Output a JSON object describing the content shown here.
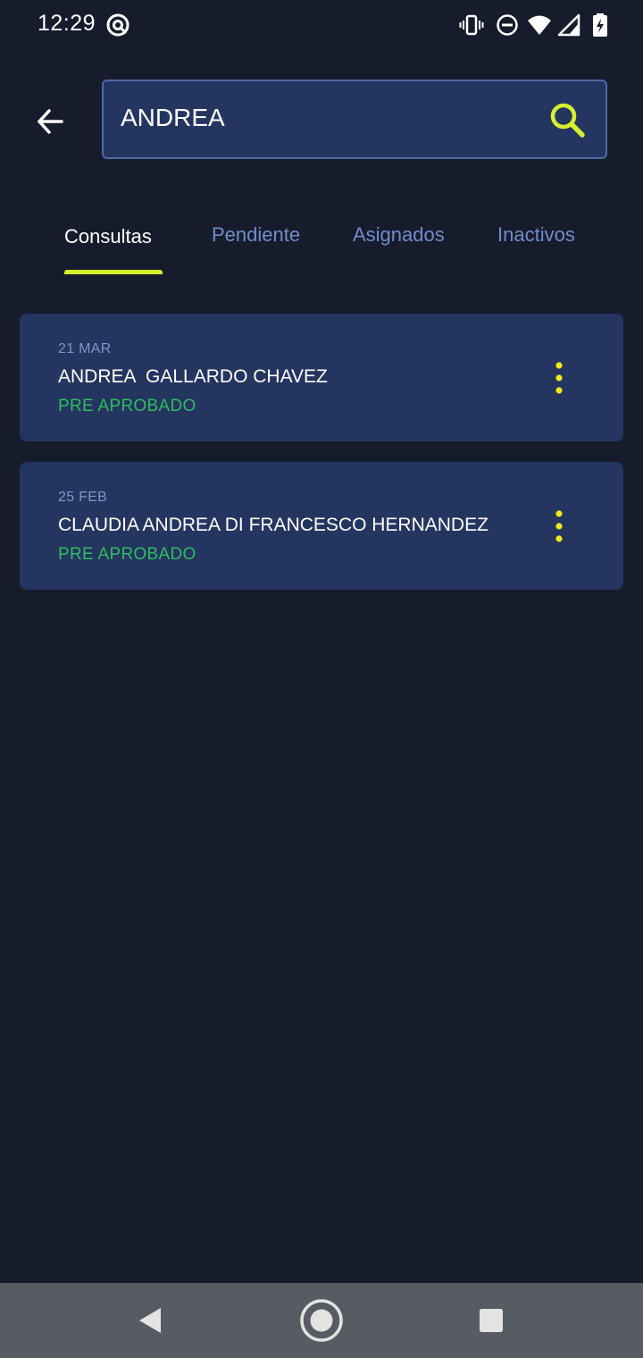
{
  "status_bar": {
    "time": "12:29"
  },
  "header": {
    "search_value": "ANDREA",
    "search_placeholder": ""
  },
  "tabs": [
    {
      "label": "Consultas",
      "active": true
    },
    {
      "label": "Pendiente",
      "active": false
    },
    {
      "label": "Asignados",
      "active": false
    },
    {
      "label": "Inactivos",
      "active": false
    }
  ],
  "results": [
    {
      "date": "21 MAR",
      "name": "ANDREA  GALLARDO CHAVEZ",
      "status": "PRE APROBADO"
    },
    {
      "date": "25 FEB",
      "name": "CLAUDIA ANDREA DI FRANCESCO HERNANDEZ",
      "status": "PRE APROBADO"
    }
  ],
  "colors": {
    "background": "#171c2c",
    "card": "#243560",
    "accent": "#d6f02e",
    "status_green": "#2ebd5f",
    "tab_inactive": "#6f8ccb"
  },
  "icons": {
    "back": "arrow-left-icon",
    "search": "search-icon",
    "menu": "more-vertical-icon",
    "nav_back": "triangle-back-icon",
    "nav_home": "circle-home-icon",
    "nav_recents": "square-recents-icon"
  }
}
